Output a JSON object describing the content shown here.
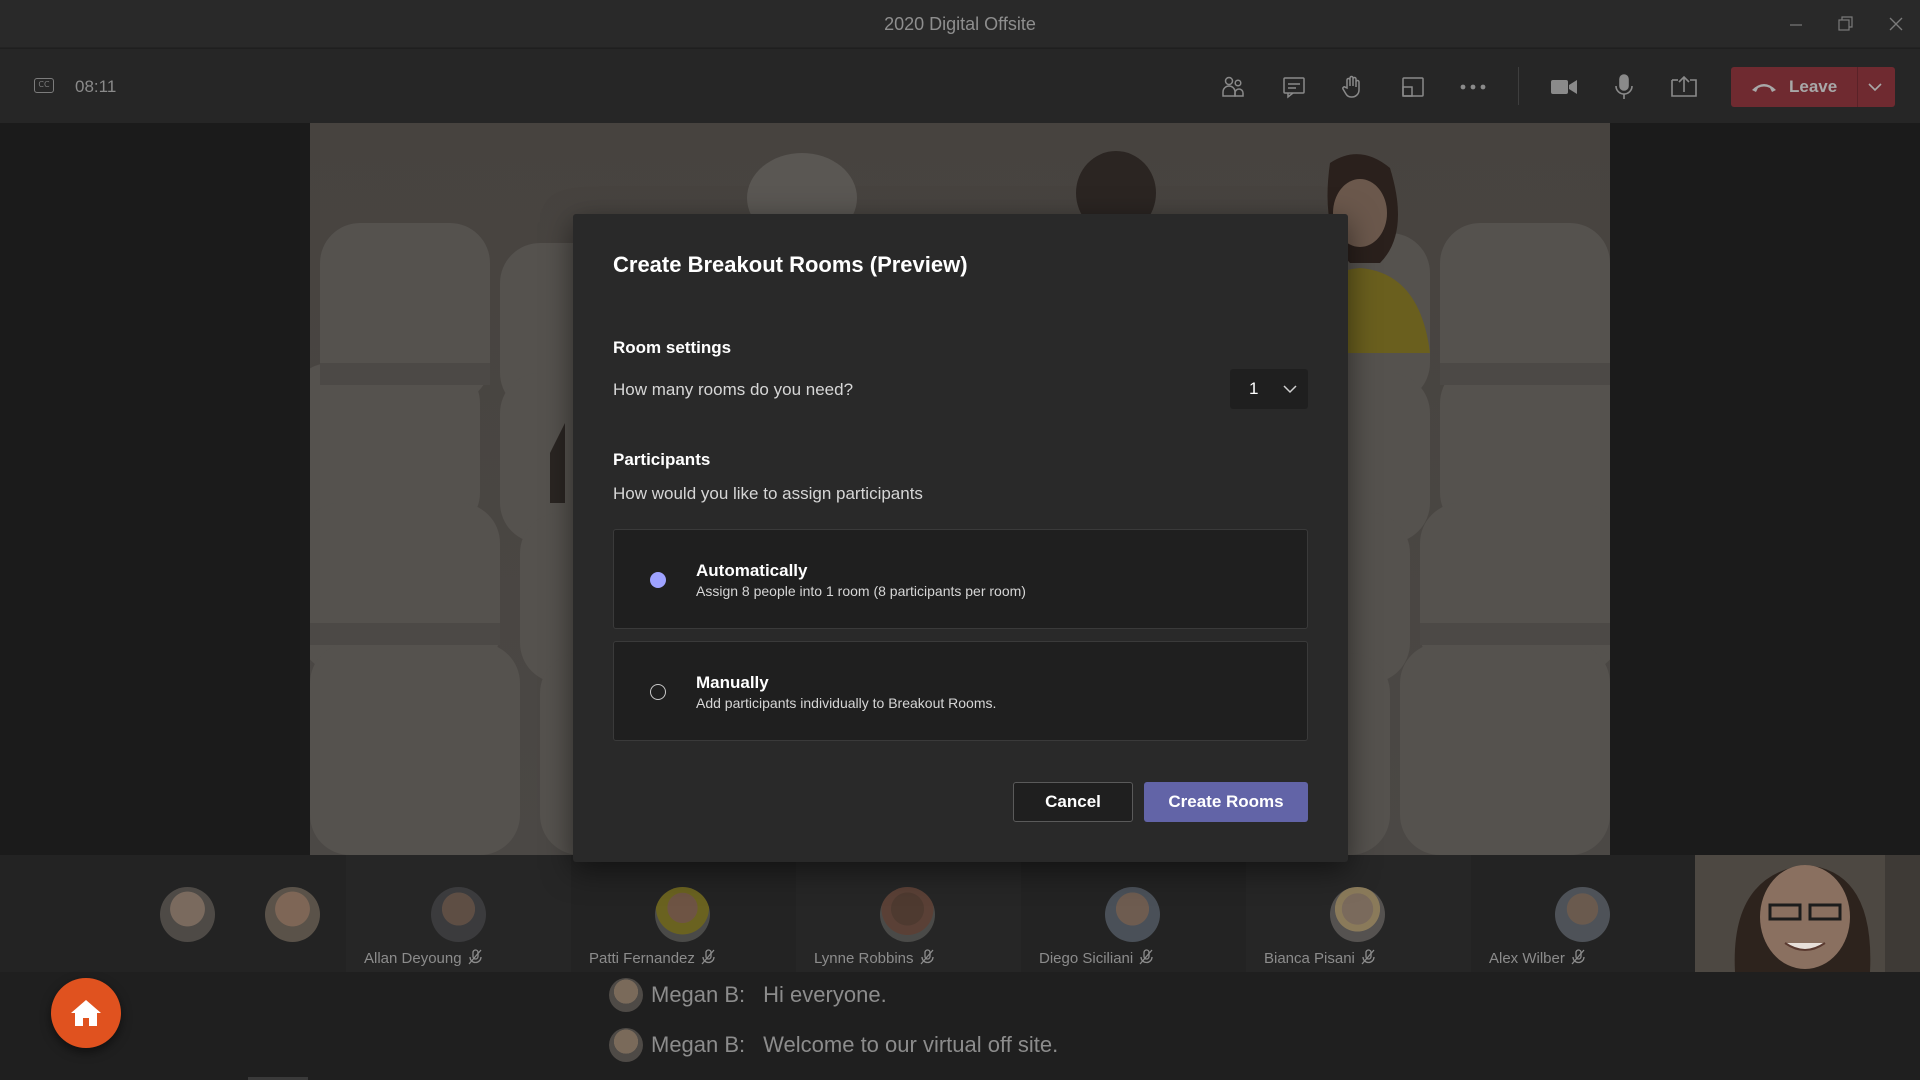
{
  "window": {
    "title": "2020 Digital Offsite"
  },
  "toolbar": {
    "timer": "08:11",
    "cc_icon_text": "CC",
    "icons": [
      "people-icon",
      "chat-icon",
      "raise-hand-icon",
      "breakout-rooms-icon",
      "more-options-icon",
      "video-camera-icon",
      "microphone-icon",
      "share-screen-icon"
    ],
    "leave_label": "Leave",
    "leave_color": "#6f2a30"
  },
  "dialog": {
    "title": "Create Breakout Rooms (Preview)",
    "room_settings_heading": "Room settings",
    "rooms_question": "How many rooms do you need?",
    "rooms_value": "1",
    "participants_heading": "Participants",
    "assign_question": "How would you like to assign participants",
    "options": [
      {
        "title": "Automatically",
        "description": "Assign 8 people into 1 room (8 participants per room)",
        "selected": true
      },
      {
        "title": "Manually",
        "description": "Add participants individually to Breakout Rooms.",
        "selected": false
      }
    ],
    "cancel_label": "Cancel",
    "create_label": "Create Rooms",
    "accent_color": "#6264a7"
  },
  "participants": [
    {
      "name": ""
    },
    {
      "name": ""
    },
    {
      "name": "Allan Deyoung",
      "muted": true
    },
    {
      "name": "Patti Fernandez",
      "muted": true
    },
    {
      "name": "Lynne Robbins",
      "muted": true
    },
    {
      "name": "Diego Siciliani",
      "muted": true
    },
    {
      "name": "Bianca Pisani",
      "muted": true
    },
    {
      "name": "Alex Wilber",
      "muted": true
    }
  ],
  "chat": [
    {
      "sender": "Megan B:",
      "message": "Hi everyone."
    },
    {
      "sender": "Megan B:",
      "message": "Welcome to our virtual off site."
    }
  ],
  "home_button_color": "#e0521f"
}
